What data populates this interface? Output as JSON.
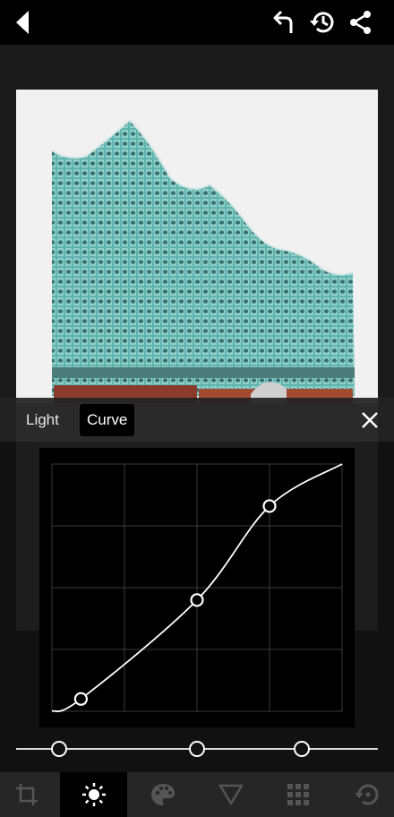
{
  "header": {
    "back_icon": "back-arrow-icon",
    "undo_icon": "undo-icon",
    "history_icon": "history-icon",
    "share_icon": "share-icon"
  },
  "photo": {
    "subject": "photo-canvas"
  },
  "adjust_tabs": {
    "items": [
      {
        "label": "Light",
        "selected": false
      },
      {
        "label": "Curve",
        "selected": true
      }
    ],
    "close_icon": "close-icon"
  },
  "curve": {
    "control_points": [
      {
        "input": 0.1,
        "output": 0.05
      },
      {
        "input": 0.5,
        "output": 0.45
      },
      {
        "input": 0.75,
        "output": 0.83
      }
    ],
    "grid_divisions": 4,
    "colors": {
      "curve": "#ffffff",
      "grid": "#3a3a3a",
      "background": "#000000"
    }
  },
  "range_slider": {
    "handles": [
      0.12,
      0.5,
      0.79
    ]
  },
  "tools": [
    {
      "icon": "crop-icon",
      "active": false
    },
    {
      "icon": "brightness-icon",
      "active": true
    },
    {
      "icon": "palette-icon",
      "active": false
    },
    {
      "icon": "triangle-filter-icon",
      "active": false
    },
    {
      "icon": "grid-dots-icon",
      "active": false
    },
    {
      "icon": "restore-icon",
      "active": false
    }
  ]
}
